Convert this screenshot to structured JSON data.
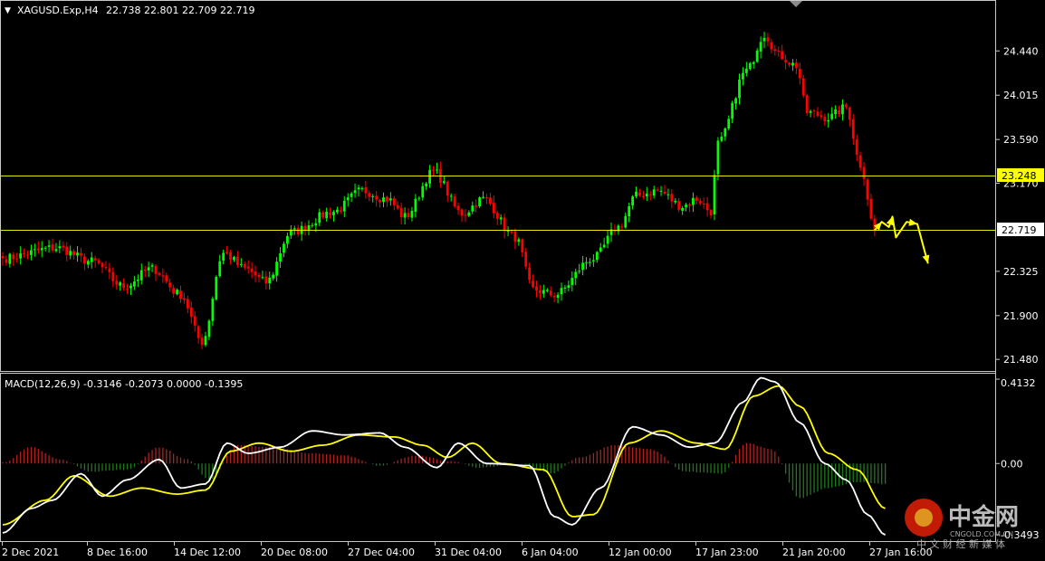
{
  "header": {
    "collapse_glyph": "▼",
    "symbol_text": "XAGUSD.Exp,H4",
    "ohlc_text": "22.738 22.801 22.709 22.719"
  },
  "macd_header": "MACD(12,26,9) -0.3146 -0.2073 0.0000 -0.1395",
  "price_axis": {
    "ticks": [
      "24.440",
      "24.015",
      "23.590",
      "23.170",
      "22.325",
      "21.900",
      "21.480"
    ],
    "tick_values": [
      24.44,
      24.015,
      23.59,
      23.17,
      22.325,
      21.9,
      21.48
    ],
    "visible_range": [
      21.36,
      24.92
    ]
  },
  "macd_axis": {
    "ticks": [
      "0.4132",
      "0.00",
      "-0.3493"
    ],
    "tick_values": [
      0.4132,
      0.0,
      -0.3493
    ],
    "range": [
      -0.38,
      0.44
    ]
  },
  "time_axis": {
    "labels": [
      "2 Dec 2021",
      "8 Dec 16:00",
      "14 Dec 12:00",
      "20 Dec 08:00",
      "27 Dec 04:00",
      "31 Dec 04:00",
      "6 Jan 04:00",
      "12 Jan 00:00",
      "17 Jan 23:00",
      "21 Jan 20:00",
      "27 Jan 16:00"
    ]
  },
  "levels": [
    {
      "label": "23.248",
      "value": 23.248,
      "box_color": "#ffff00",
      "text_color": "#000000"
    },
    {
      "label": "22.719",
      "value": 22.719,
      "box_color": "#ffffff",
      "text_color": "#000000"
    }
  ],
  "watermark": {
    "brand_cn": "中金网",
    "brand_en": "CNGOLD.COM.CN",
    "tagline": "中 文 财 经 新 媒 体"
  },
  "colors": {
    "background": "#000000",
    "bull": "#00ff00",
    "bear": "#ff0000",
    "grid_frame": "#c8c8c8",
    "level_line": "#ffff00",
    "macd_main": "#ffffff",
    "macd_signal": "#ffff00",
    "hist_pos": "#b02020",
    "hist_neg": "#1e7a1e",
    "forecast_arrow": "#ffff00",
    "axis_text": "#ffffff"
  },
  "chart_data": [
    {
      "type": "candlestick",
      "symbol": "XAGUSD.Exp",
      "timeframe": "H4",
      "title": "XAGUSD.Exp,H4",
      "x_labels": [
        "2 Dec 2021",
        "8 Dec 16:00",
        "14 Dec 12:00",
        "20 Dec 08:00",
        "27 Dec 04:00",
        "31 Dec 04:00",
        "6 Jan 04:00",
        "12 Jan 00:00",
        "17 Jan 23:00",
        "21 Jan 20:00",
        "27 Jan 16:00"
      ],
      "anchor_closes": [
        [
          0,
          22.45
        ],
        [
          15,
          22.55
        ],
        [
          25,
          22.42
        ],
        [
          34,
          22.18
        ],
        [
          42,
          22.35
        ],
        [
          50,
          22.1
        ],
        [
          56,
          21.65
        ],
        [
          62,
          22.5
        ],
        [
          68,
          22.35
        ],
        [
          74,
          22.22
        ],
        [
          81,
          22.7
        ],
        [
          93,
          22.9
        ],
        [
          101,
          23.1
        ],
        [
          108,
          23.02
        ],
        [
          113,
          22.85
        ],
        [
          121,
          23.28
        ],
        [
          129,
          22.88
        ],
        [
          135,
          23.02
        ],
        [
          144,
          22.65
        ],
        [
          149,
          22.15
        ],
        [
          155,
          22.1
        ],
        [
          166,
          22.45
        ],
        [
          173,
          22.75
        ],
        [
          178,
          23.05
        ],
        [
          184,
          23.1
        ],
        [
          191,
          22.95
        ],
        [
          195,
          23.02
        ],
        [
          199,
          22.9
        ],
        [
          201,
          23.55
        ],
        [
          209,
          24.25
        ],
        [
          214,
          24.6
        ],
        [
          218,
          24.4
        ],
        [
          223,
          24.3
        ],
        [
          226,
          23.85
        ],
        [
          232,
          23.8
        ],
        [
          237,
          23.9
        ],
        [
          241,
          23.35
        ],
        [
          245,
          22.719
        ]
      ],
      "ylim": [
        21.36,
        24.92
      ],
      "horizontal_levels": [
        23.248,
        22.719
      ],
      "forecast_path": [
        [
          245,
          22.719
        ],
        [
          247,
          22.8
        ],
        [
          249,
          22.75
        ],
        [
          250,
          22.85
        ],
        [
          251,
          22.65
        ],
        [
          254,
          22.8
        ],
        [
          257,
          22.78
        ],
        [
          260,
          22.4
        ]
      ]
    },
    {
      "type": "line",
      "title": "MACD(12,26,9) -0.3146 -0.2073 0.0000 -0.1395",
      "x_labels": [
        "2 Dec 2021",
        "8 Dec 16:00",
        "14 Dec 12:00",
        "20 Dec 08:00",
        "27 Dec 04:00",
        "31 Dec 04:00",
        "6 Jan 04:00",
        "12 Jan 00:00",
        "17 Jan 23:00",
        "21 Jan 20:00",
        "27 Jan 16:00"
      ],
      "ylim": [
        -0.38,
        0.44
      ],
      "series": [
        {
          "values": [
            [
              0,
              -0.34
            ],
            [
              8,
              -0.22
            ],
            [
              14,
              -0.18
            ],
            [
              22,
              -0.05
            ],
            [
              28,
              -0.16
            ],
            [
              35,
              -0.08
            ],
            [
              44,
              0.02
            ],
            [
              50,
              -0.12
            ],
            [
              57,
              -0.1
            ],
            [
              63,
              0.1
            ],
            [
              69,
              0.05
            ],
            [
              78,
              0.08
            ],
            [
              87,
              0.16
            ],
            [
              96,
              0.14
            ],
            [
              106,
              0.15
            ],
            [
              113,
              0.08
            ],
            [
              122,
              -0.02
            ],
            [
              128,
              0.1
            ],
            [
              136,
              0.0
            ],
            [
              148,
              -0.01
            ],
            [
              155,
              -0.26
            ],
            [
              160,
              -0.3
            ],
            [
              168,
              -0.12
            ],
            [
              177,
              0.18
            ],
            [
              185,
              0.14
            ],
            [
              193,
              0.08
            ],
            [
              200,
              0.1
            ],
            [
              208,
              0.3
            ],
            [
              213,
              0.42
            ],
            [
              217,
              0.4
            ],
            [
              224,
              0.2
            ],
            [
              231,
              0.0
            ],
            [
              237,
              -0.08
            ],
            [
              243,
              -0.25
            ],
            [
              248,
              -0.35
            ]
          ]
        },
        {
          "values": [
            [
              0,
              -0.3
            ],
            [
              12,
              -0.18
            ],
            [
              20,
              -0.06
            ],
            [
              30,
              -0.16
            ],
            [
              39,
              -0.12
            ],
            [
              49,
              -0.15
            ],
            [
              57,
              -0.13
            ],
            [
              64,
              0.06
            ],
            [
              72,
              0.1
            ],
            [
              81,
              0.06
            ],
            [
              90,
              0.09
            ],
            [
              100,
              0.14
            ],
            [
              110,
              0.13
            ],
            [
              118,
              0.09
            ],
            [
              125,
              0.03
            ],
            [
              132,
              0.1
            ],
            [
              140,
              0.0
            ],
            [
              152,
              -0.03
            ],
            [
              160,
              -0.26
            ],
            [
              166,
              -0.25
            ],
            [
              176,
              0.1
            ],
            [
              185,
              0.16
            ],
            [
              195,
              0.1
            ],
            [
              203,
              0.07
            ],
            [
              211,
              0.33
            ],
            [
              218,
              0.38
            ],
            [
              224,
              0.28
            ],
            [
              232,
              0.05
            ],
            [
              240,
              -0.03
            ],
            [
              248,
              -0.22
            ]
          ]
        }
      ],
      "histogram_anchors": [
        [
          0,
          0.005
        ],
        [
          8,
          0.08
        ],
        [
          16,
          0.02
        ],
        [
          25,
          -0.04
        ],
        [
          35,
          -0.03
        ],
        [
          44,
          0.08
        ],
        [
          52,
          0.02
        ],
        [
          58,
          -0.08
        ],
        [
          66,
          0.09
        ],
        [
          76,
          0.08
        ],
        [
          86,
          0.05
        ],
        [
          96,
          0.04
        ],
        [
          106,
          -0.01
        ],
        [
          116,
          0.04
        ],
        [
          126,
          0.01
        ],
        [
          134,
          -0.02
        ],
        [
          146,
          0.0
        ],
        [
          154,
          -0.05
        ],
        [
          162,
          0.03
        ],
        [
          172,
          0.09
        ],
        [
          182,
          0.07
        ],
        [
          192,
          -0.04
        ],
        [
          202,
          -0.05
        ],
        [
          209,
          0.1
        ],
        [
          216,
          0.07
        ],
        [
          224,
          -0.17
        ],
        [
          232,
          -0.12
        ],
        [
          240,
          -0.09
        ],
        [
          248,
          -0.1
        ]
      ]
    }
  ]
}
